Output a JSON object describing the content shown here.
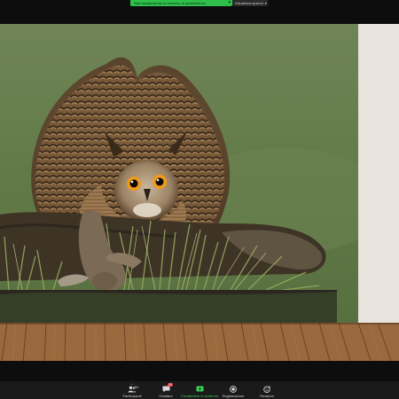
{
  "share_banner": {
    "label": "Stai visualizzando lo schermo di qualcheduno",
    "accent": "#2ec04a"
  },
  "view_options": {
    "label": "Visualizza opzioni"
  },
  "toolbar": {
    "items": [
      {
        "label": "Partecipanti",
        "icon": "participants-icon",
        "count": "90"
      },
      {
        "label": "Chattare",
        "icon": "chat-icon",
        "badge": "33"
      },
      {
        "label": "Condividere lo schermo",
        "icon": "share-screen-icon",
        "active": true
      },
      {
        "label": "Registrazione",
        "icon": "record-icon"
      },
      {
        "label": "Reazioni",
        "icon": "reactions-icon"
      }
    ]
  },
  "colors": {
    "toolbar_bg": "#1a1a1a",
    "active_green": "#3ad15a",
    "badge_red": "#e0363a",
    "floor_wood": "#9a6a3e"
  }
}
